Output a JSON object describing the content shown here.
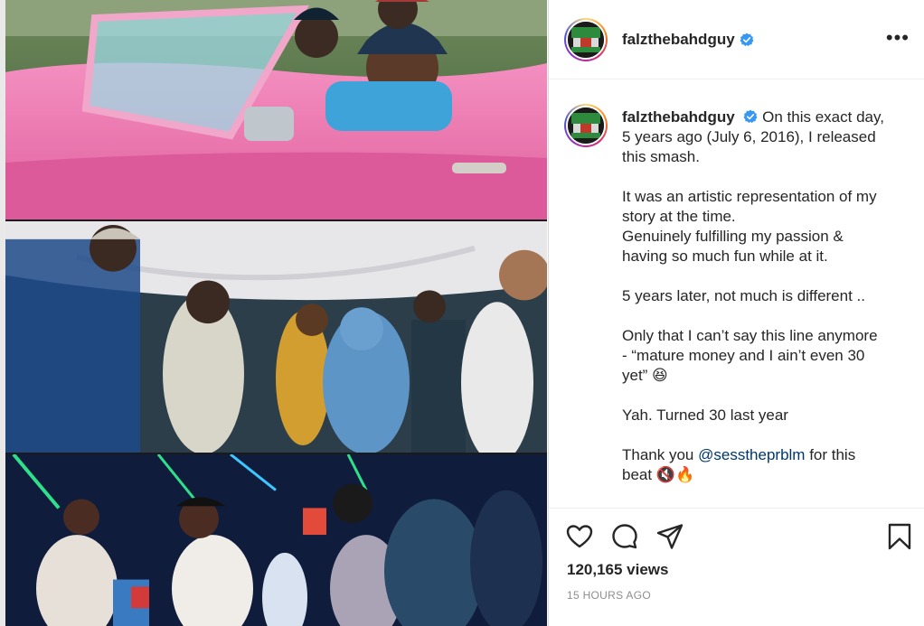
{
  "post": {
    "username": "falzthebahdguy",
    "verified": true,
    "more_icon": "more-horizontal-icon",
    "caption_lines": [
      "5 years ago (July 6, 2016), I released",
      "this smash.",
      "",
      "It was an artistic representation of my",
      "story at the time.",
      "Genuinely fulfilling my passion &",
      "having so much fun while at it.",
      "",
      "5 years later, not much is different ..",
      "",
      "Only that I can’t say this line anymore",
      "- “mature money and I ain’t even 30",
      "yet” 😆",
      "",
      "Yah. Turned 30 last year",
      ""
    ],
    "caption_first": "On this exact day,",
    "thanks_prefix": "Thank you ",
    "mention": "@sesstheprblm",
    "thanks_suffix": " for this",
    "last_line": "beat 🔇🔥",
    "views": "120,165 views",
    "timestamp": "15 HOURS AGO"
  },
  "icons": {
    "like": "heart-icon",
    "comment": "comment-icon",
    "share": "share-icon",
    "save": "bookmark-icon",
    "verified": "verified-badge-icon"
  },
  "colors": {
    "verified_blue": "#3897f0",
    "mention": "#00376b",
    "secondary_text": "#8e8e8e"
  }
}
